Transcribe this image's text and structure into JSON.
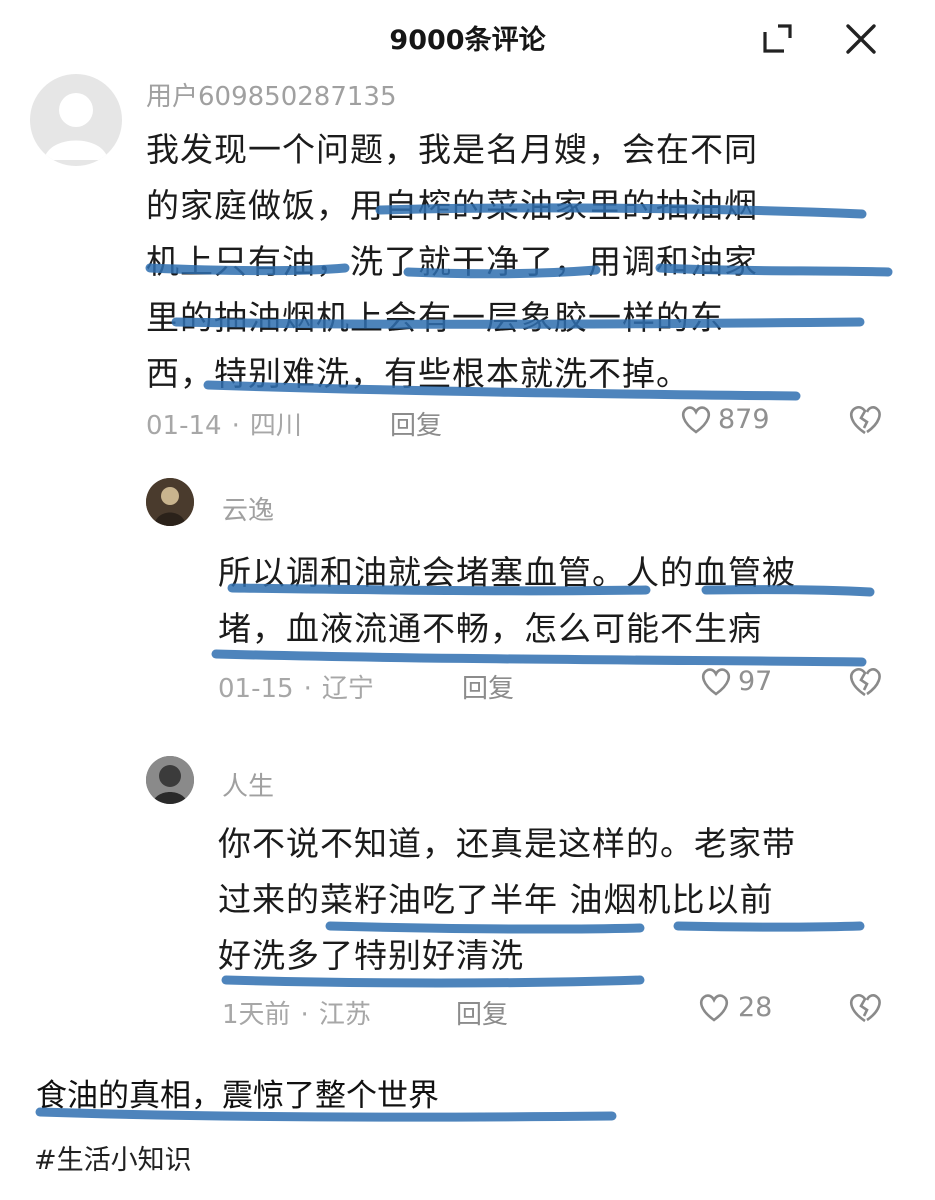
{
  "header": {
    "title": "9000条评论",
    "expand_icon": "minimize-corner-icon",
    "close_icon": "close-icon"
  },
  "comments": [
    {
      "user": "用户609850287135",
      "avatar_icon": "default-avatar-icon",
      "lines": [
        "我发现一个问题，我是名月嫂，会在不同",
        "的家庭做饭，用自榨的菜油家里的抽油烟",
        "机上只有油，洗了就干净了，用调和油家",
        "里的抽油烟机上会有一层象胶一样的东",
        "西，特别难洗，有些根本就洗不掉。"
      ],
      "date": "01-14",
      "location": "四川",
      "reply_label": "回复",
      "likes": "879"
    },
    {
      "user": "云逸",
      "avatar_icon": "user-photo-avatar",
      "lines": [
        "所以调和油就会堵塞血管。人的血管被",
        "堵，血液流通不畅，怎么可能不生病"
      ],
      "date": "01-15",
      "location": "辽宁",
      "reply_label": "回复",
      "likes": "97"
    },
    {
      "user": "人生",
      "avatar_icon": "user-photo-avatar",
      "lines": [
        "你不说不知道，还真是这样的。老家带",
        "过来的菜籽油吃了半年 油烟机比以前",
        "好洗多了特别好清洗"
      ],
      "date": "1天前",
      "location": "江苏",
      "reply_label": "回复",
      "likes": "28"
    }
  ],
  "footer": {
    "caption": "食油的真相，震惊了整个世界",
    "hashtag": "#生活小知识"
  },
  "colors": {
    "highlight_stroke": "#2f6fb0",
    "text": "#1b1b1b",
    "meta": "#a7a7a7"
  }
}
